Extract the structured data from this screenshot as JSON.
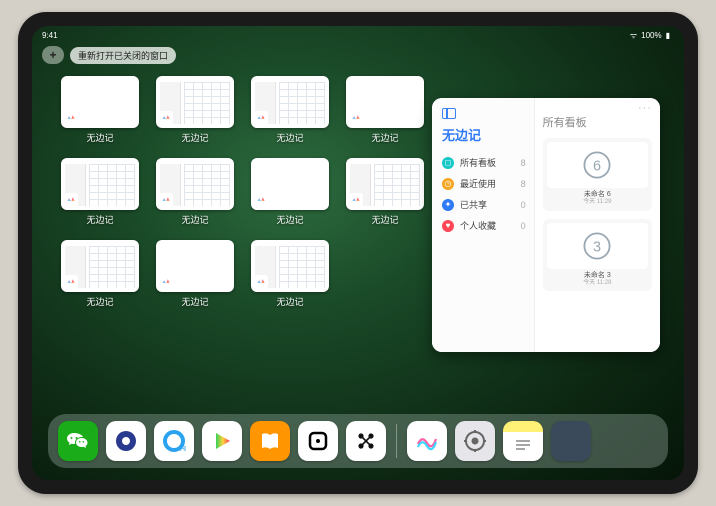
{
  "status": {
    "time": "9:41",
    "battery": "100%"
  },
  "topbar": {
    "add_label": "+",
    "reopen_label": "重新打开已关闭的窗口"
  },
  "app_switcher": {
    "app_name": "无边记",
    "cards": [
      {
        "label": "无边记",
        "variant": "blank"
      },
      {
        "label": "无边记",
        "variant": "content"
      },
      {
        "label": "无边记",
        "variant": "content"
      },
      {
        "label": "无边记",
        "variant": "blank"
      },
      {
        "label": "无边记",
        "variant": "content"
      },
      {
        "label": "无边记",
        "variant": "content"
      },
      {
        "label": "无边记",
        "variant": "blank"
      },
      {
        "label": "无边记",
        "variant": "content"
      },
      {
        "label": "无边记",
        "variant": "content"
      },
      {
        "label": "无边记",
        "variant": "blank"
      },
      {
        "label": "无边记",
        "variant": "content"
      }
    ]
  },
  "popup": {
    "left_title": "无边记",
    "items": [
      {
        "label": "所有看板",
        "count": "8",
        "color": "all"
      },
      {
        "label": "最近使用",
        "count": "8",
        "color": "recent"
      },
      {
        "label": "已共享",
        "count": "0",
        "color": "shared"
      },
      {
        "label": "个人收藏",
        "count": "0",
        "color": "fav"
      }
    ],
    "right_title": "所有看板",
    "right_more": "···",
    "boards": [
      {
        "name": "未命名 6",
        "sub": "今天 11:29",
        "digit": "6"
      },
      {
        "name": "未命名 3",
        "sub": "今天 11:28",
        "digit": "3"
      }
    ]
  },
  "dock": {
    "icons": [
      {
        "name": "wechat",
        "color": "di-wechat"
      },
      {
        "name": "quark",
        "color": "di-quark"
      },
      {
        "name": "browser",
        "color": "di-browser"
      },
      {
        "name": "play",
        "color": "di-play"
      },
      {
        "name": "books",
        "color": "di-books"
      },
      {
        "name": "blackbox",
        "color": "di-blackbox"
      },
      {
        "name": "dots",
        "color": "di-dots"
      }
    ],
    "recent": [
      {
        "name": "freeform",
        "color": "di-freeform"
      },
      {
        "name": "settings",
        "color": "di-settings"
      },
      {
        "name": "notes",
        "color": "di-notes"
      },
      {
        "name": "app-library",
        "color": "di-library"
      }
    ]
  }
}
